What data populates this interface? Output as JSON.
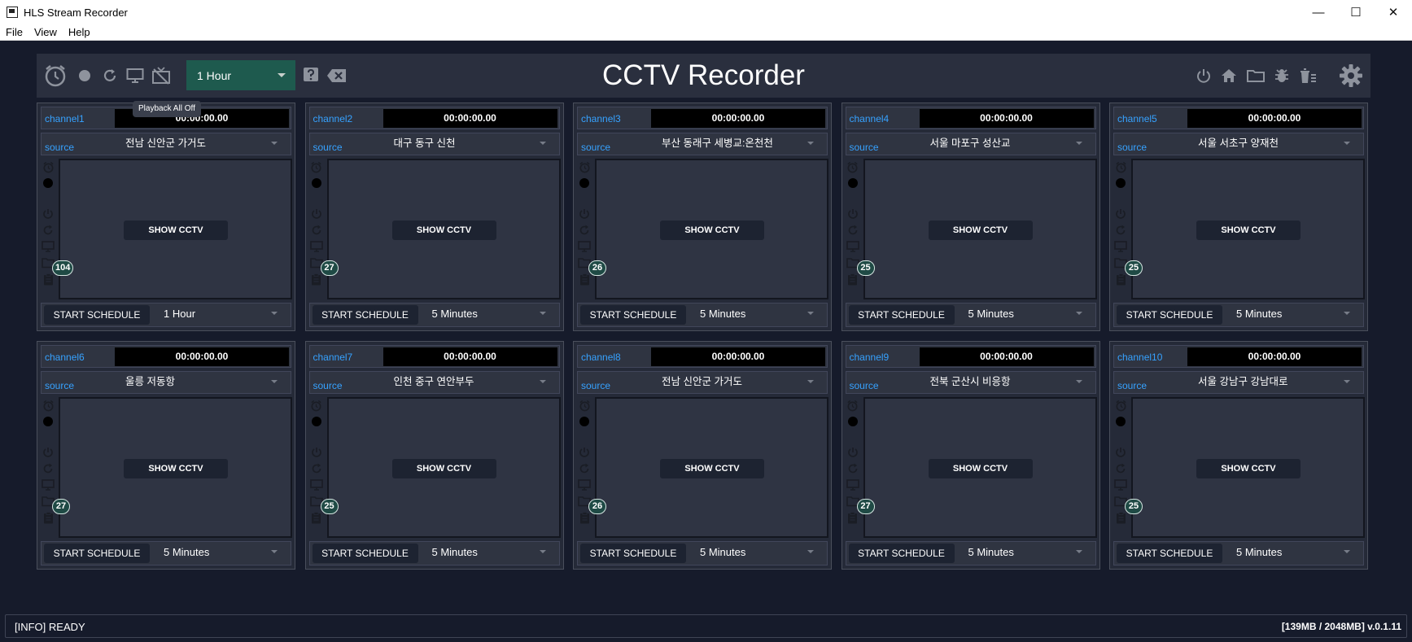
{
  "window": {
    "title": "HLS Stream Recorder",
    "controls": {
      "minimize": "—",
      "maximize": "☐",
      "close": "✕"
    }
  },
  "menu": [
    "File",
    "View",
    "Help"
  ],
  "toolbar": {
    "duration_selected": "1 Hour",
    "app_title": "CCTV Recorder",
    "tooltip": "Playback All Off",
    "left_icons": [
      "alarm-clock-icon",
      "record-dot-icon",
      "refresh-icon",
      "monitor-icon",
      "tv-off-icon"
    ],
    "right_icons": [
      "power-icon",
      "home-icon",
      "folder-icon",
      "bug-icon",
      "trash-icon",
      "gear-icon"
    ]
  },
  "colors": {
    "background": "#161b2b",
    "panel": "#252a38",
    "accent_blue": "#36a2ff",
    "dropdown_green": "#1e5a4e"
  },
  "channels": [
    {
      "label": "channel1",
      "time": "00:00:00.00",
      "source_label": "source",
      "source": "전남 신안군 가거도",
      "show_label": "SHOW CCTV",
      "count": "104",
      "schedule_label": "START SCHEDULE",
      "interval": "1 Hour"
    },
    {
      "label": "channel2",
      "time": "00:00:00.00",
      "source_label": "source",
      "source": "대구 동구 신천",
      "show_label": "SHOW CCTV",
      "count": "27",
      "schedule_label": "START SCHEDULE",
      "interval": "5 Minutes"
    },
    {
      "label": "channel3",
      "time": "00:00:00.00",
      "source_label": "source",
      "source": "부산 동래구 세병교:온천천",
      "show_label": "SHOW CCTV",
      "count": "26",
      "schedule_label": "START SCHEDULE",
      "interval": "5 Minutes"
    },
    {
      "label": "channel4",
      "time": "00:00:00.00",
      "source_label": "source",
      "source": "서울 마포구 성산교",
      "show_label": "SHOW CCTV",
      "count": "25",
      "schedule_label": "START SCHEDULE",
      "interval": "5 Minutes"
    },
    {
      "label": "channel5",
      "time": "00:00:00.00",
      "source_label": "source",
      "source": "서울 서초구 양재천",
      "show_label": "SHOW CCTV",
      "count": "25",
      "schedule_label": "START SCHEDULE",
      "interval": "5 Minutes"
    },
    {
      "label": "channel6",
      "time": "00:00:00.00",
      "source_label": "source",
      "source": "울릉 저동항",
      "show_label": "SHOW CCTV",
      "count": "27",
      "schedule_label": "START SCHEDULE",
      "interval": "5 Minutes"
    },
    {
      "label": "channel7",
      "time": "00:00:00.00",
      "source_label": "source",
      "source": "인천 중구 연안부두",
      "show_label": "SHOW CCTV",
      "count": "25",
      "schedule_label": "START SCHEDULE",
      "interval": "5 Minutes"
    },
    {
      "label": "channel8",
      "time": "00:00:00.00",
      "source_label": "source",
      "source": "전남 신안군 가거도",
      "show_label": "SHOW CCTV",
      "count": "26",
      "schedule_label": "START SCHEDULE",
      "interval": "5 Minutes"
    },
    {
      "label": "channel9",
      "time": "00:00:00.00",
      "source_label": "source",
      "source": "전북 군산시 비응항",
      "show_label": "SHOW CCTV",
      "count": "27",
      "schedule_label": "START SCHEDULE",
      "interval": "5 Minutes"
    },
    {
      "label": "channel10",
      "time": "00:00:00.00",
      "source_label": "source",
      "source": "서울 강남구 강남대로",
      "show_label": "SHOW CCTV",
      "count": "25",
      "schedule_label": "START SCHEDULE",
      "interval": "5 Minutes"
    }
  ],
  "status": {
    "message": "[INFO] READY",
    "memory_version": "[139MB / 2048MB] v.0.1.11"
  }
}
